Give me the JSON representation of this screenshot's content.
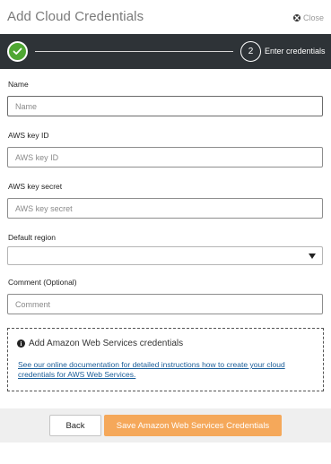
{
  "dialog": {
    "title": "Add Cloud Credentials",
    "close_label": "Close"
  },
  "steps": [
    {
      "number": "1",
      "status": "complete",
      "icon": "check-icon"
    },
    {
      "number": "2",
      "label": "Enter credentials",
      "status": "current"
    }
  ],
  "form": {
    "name": {
      "label": "Name",
      "placeholder": "Name",
      "value": ""
    },
    "key_id": {
      "label": "AWS key ID",
      "placeholder": "AWS key ID",
      "value": ""
    },
    "key_secret": {
      "label": "AWS key secret",
      "placeholder": "AWS key secret",
      "value": ""
    },
    "region": {
      "label": "Default region",
      "selected": ""
    },
    "comment": {
      "label": "Comment (Optional)",
      "placeholder": "Comment",
      "value": ""
    }
  },
  "info": {
    "heading": "Add Amazon Web Services credentials",
    "link_text": "See our online documentation for detailed instructions how to create your cloud credentials for AWS Web Services."
  },
  "footer": {
    "back_label": "Back",
    "save_label": "Save Amazon Web Services Credentials"
  },
  "colors": {
    "stepbar_bg": "#2e3337",
    "step_complete": "#4fa733",
    "save_button": "#f5a85a",
    "link": "#1a5d99"
  }
}
